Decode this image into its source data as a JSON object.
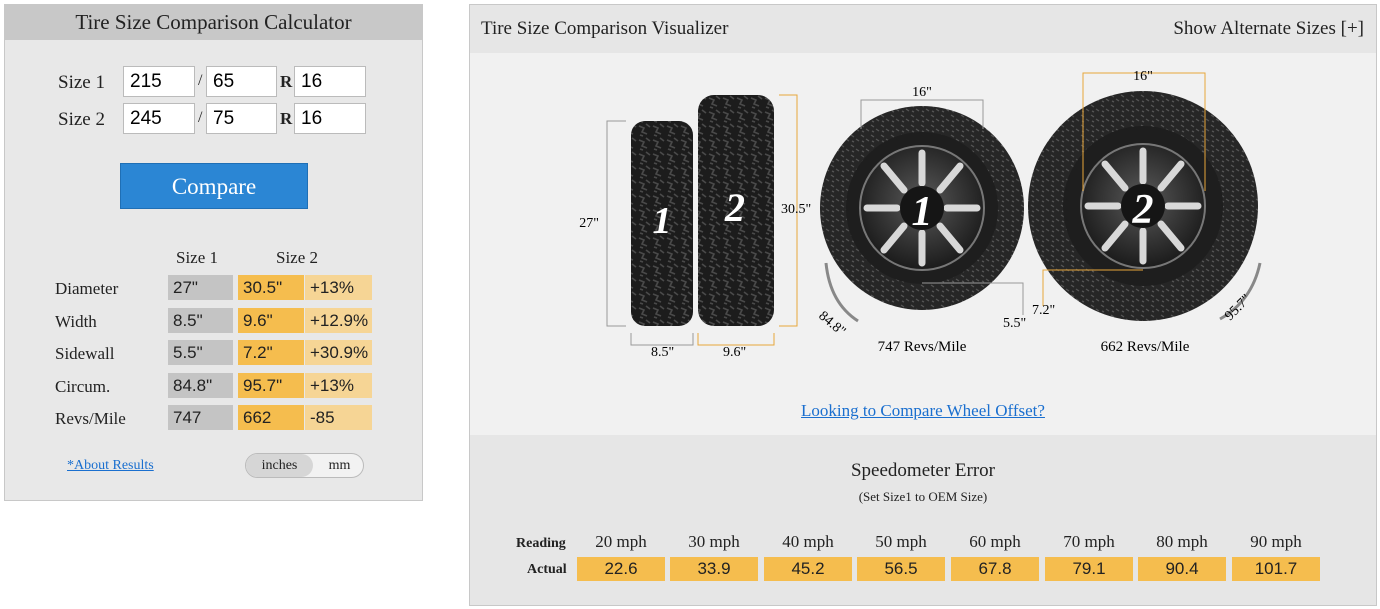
{
  "calculator": {
    "title": "Tire Size Comparison Calculator",
    "size1": {
      "label": "Size 1",
      "width": "215",
      "ratio": "65",
      "rim": "16"
    },
    "size2": {
      "label": "Size 2",
      "width": "245",
      "ratio": "75",
      "rim": "16"
    },
    "slash": "/",
    "r_char": "R",
    "compare_label": "Compare",
    "col_size1": "Size 1",
    "col_size2": "Size 2",
    "results": [
      {
        "label": "Diameter",
        "s1": "27\"",
        "s2": "30.5\"",
        "diff": "+13%"
      },
      {
        "label": "Width",
        "s1": "8.5\"",
        "s2": "9.6\"",
        "diff": "+12.9%"
      },
      {
        "label": "Sidewall",
        "s1": "5.5\"",
        "s2": "7.2\"",
        "diff": "+30.9%"
      },
      {
        "label": "Circum.",
        "s1": "84.8\"",
        "s2": "95.7\"",
        "diff": "+13%"
      },
      {
        "label": "Revs/Mile",
        "s1": "747",
        "s2": "662",
        "diff": "-85"
      }
    ],
    "about_link": "*About Results",
    "unit_inches": "inches",
    "unit_mm": "mm"
  },
  "visualizer": {
    "title": "Tire Size Comparison Visualizer",
    "alt_sizes": "Show Alternate Sizes [+]",
    "tire1_number": "1",
    "tire2_number": "2",
    "dim_diam1": "27\"",
    "dim_diam2": "30.5\"",
    "dim_width1": "8.5\"",
    "dim_width2": "9.6\"",
    "dim_rim1": "16\"",
    "dim_rim2": "16\"",
    "dim_sidewall1": "5.5\"",
    "dim_sidewall2": "7.2\"",
    "dim_circ1": "84.8\"",
    "dim_circ2": "95.7\"",
    "revs1": "747 Revs/Mile",
    "revs2": "662 Revs/Mile",
    "offset_link": "Looking to Compare Wheel Offset?"
  },
  "speedometer": {
    "title": "Speedometer Error",
    "subtitle": "(Set Size1 to OEM Size)",
    "reading_label": "Reading",
    "actual_label": "Actual",
    "readings": [
      "20 mph",
      "30 mph",
      "40 mph",
      "50 mph",
      "60 mph",
      "70 mph",
      "80 mph",
      "90 mph"
    ],
    "actuals": [
      "22.6",
      "33.9",
      "45.2",
      "56.5",
      "67.8",
      "79.1",
      "90.4",
      "101.7"
    ]
  },
  "colors": {
    "accent_blue": "#2b86d4",
    "size2_orange": "#f5bd4e",
    "diff_light": "#f6d595",
    "size1_gray": "#c4c4c4"
  }
}
